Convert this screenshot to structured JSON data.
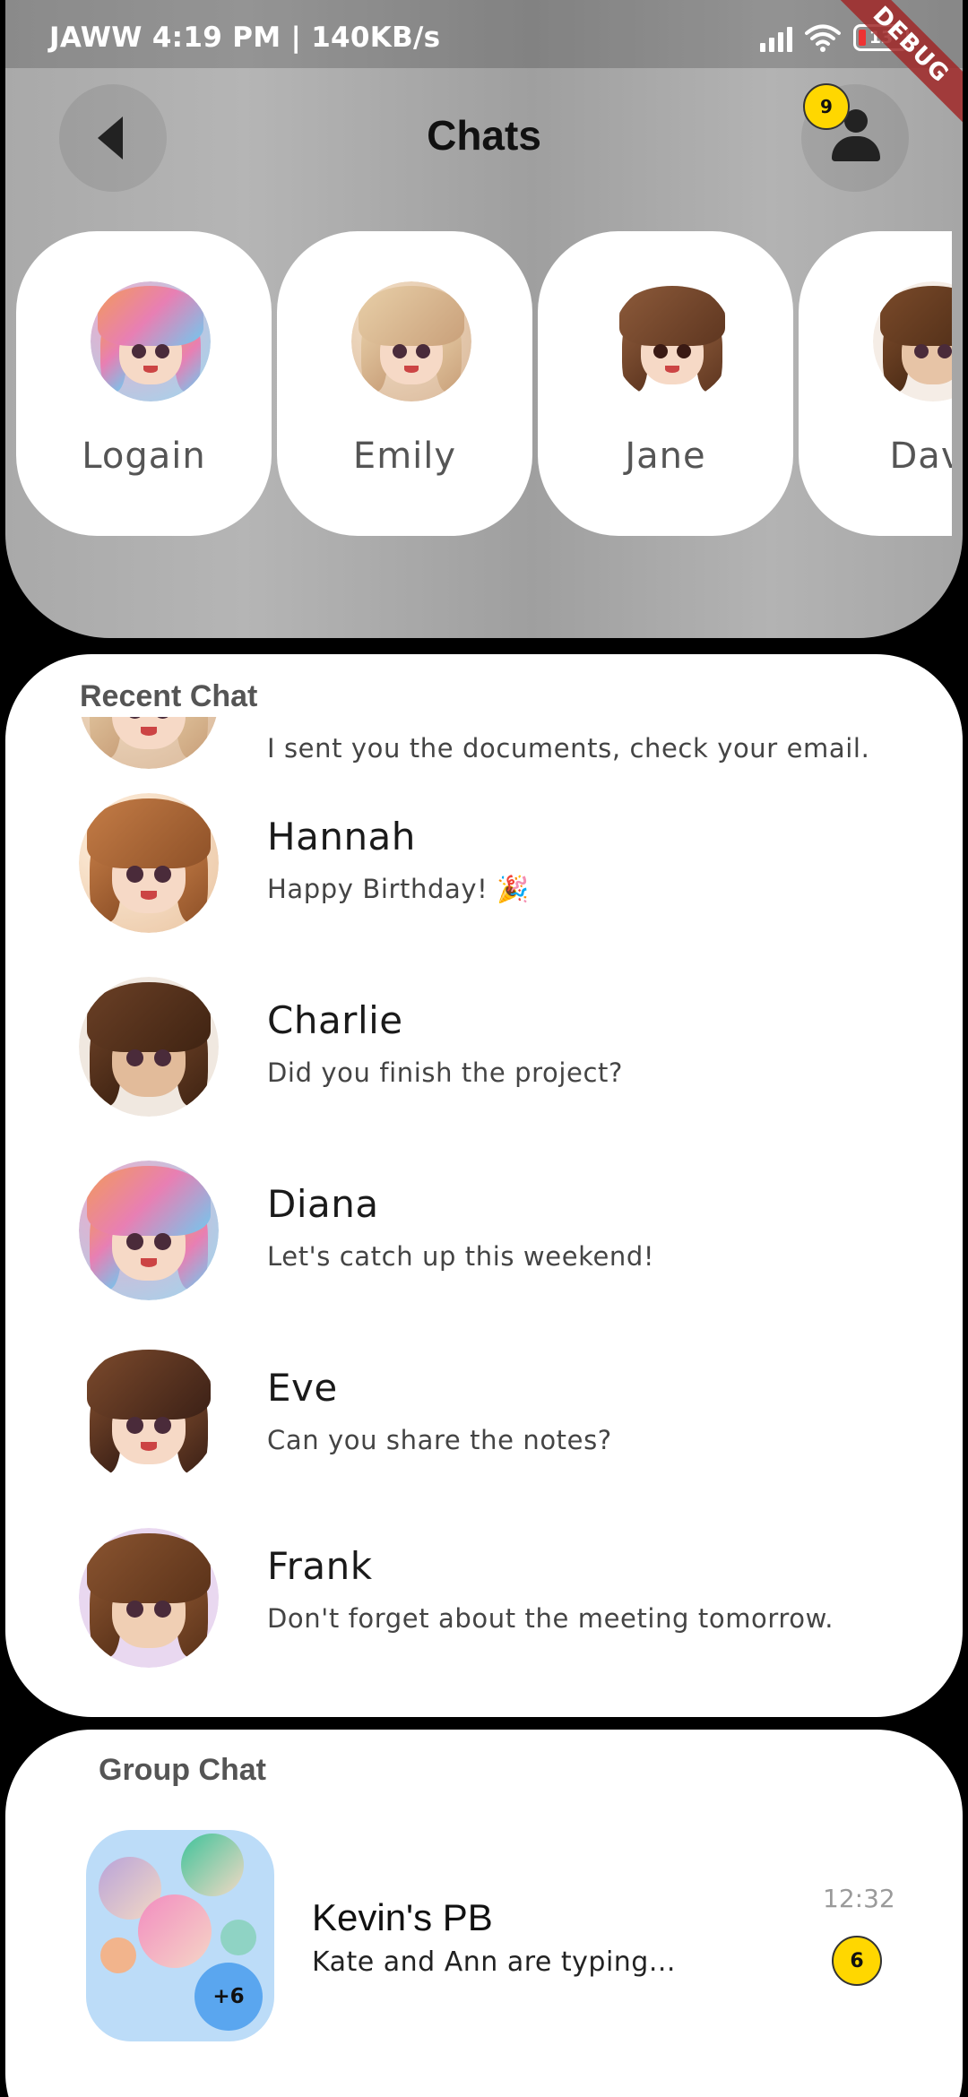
{
  "status_bar": {
    "text": "JAWW  4:19 PM | 140KB/s",
    "battery": "13"
  },
  "debug_banner": "DEBUG",
  "header": {
    "title": "Chats",
    "notification_count": "9"
  },
  "stories": [
    {
      "name": "Logain",
      "avatar": "anime-girl-avatar"
    },
    {
      "name": "Emily",
      "avatar": "anime-girl-avatar"
    },
    {
      "name": "Jane",
      "avatar": "anime-girl-avatar"
    },
    {
      "name": "Dav",
      "avatar": "anime-boy-avatar"
    }
  ],
  "recent_chat": {
    "title": "Recent Chat",
    "items": [
      {
        "name": "",
        "message": "I sent you the documents, check your email."
      },
      {
        "name": "Hannah",
        "message": "Happy Birthday! 🎉"
      },
      {
        "name": "Charlie",
        "message": "Did you finish the project?"
      },
      {
        "name": "Diana",
        "message": "Let's catch up this weekend!"
      },
      {
        "name": "Eve",
        "message": "Can you share the notes?"
      },
      {
        "name": "Frank",
        "message": "Don't forget about the meeting tomorrow."
      }
    ]
  },
  "group_chat": {
    "title": "Group Chat",
    "items": [
      {
        "name": "Kevin's PB",
        "message": "Kate and Ann are typing...",
        "time": "12:32",
        "unread": "6",
        "member_extra": "+6"
      }
    ]
  },
  "colors": {
    "badge": "#ffd700",
    "group_avatar_bg": "#bcdcf8",
    "member_count_bg": "#5aa6ef"
  }
}
